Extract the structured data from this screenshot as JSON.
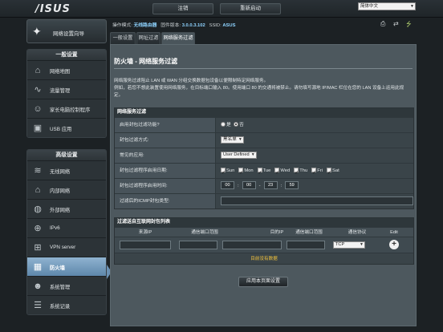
{
  "header": {
    "logo": "/ISUS",
    "logout_label": "注销",
    "reboot_label": "重新启动",
    "language": "简体中文"
  },
  "status": {
    "mode_label": "操作模式:",
    "mode_value": "无线路由器",
    "firmware_label": "固件版本:",
    "firmware_value": "3.0.0.3.102",
    "ssid_label": "SSID:",
    "ssid_value": "ASUS"
  },
  "sidebar": {
    "qis_label": "网络设置向导",
    "general_title": "一般设置",
    "general_items": [
      {
        "label": "网络地图",
        "icon": "network-map-icon"
      },
      {
        "label": "流量管理",
        "icon": "traffic-icon"
      },
      {
        "label": "家长电脑控制程序",
        "icon": "parental-control-icon"
      },
      {
        "label": "USB 应用",
        "icon": "usb-icon"
      }
    ],
    "advanced_title": "高级设置",
    "advanced_items": [
      {
        "label": "无线网络",
        "icon": "wireless-icon"
      },
      {
        "label": "内部网络",
        "icon": "lan-icon"
      },
      {
        "label": "外部网络",
        "icon": "wan-icon"
      },
      {
        "label": "IPv6",
        "icon": "ipv6-icon"
      },
      {
        "label": "VPN server",
        "icon": "vpn-icon"
      },
      {
        "label": "防火墙",
        "icon": "firewall-icon",
        "active": true
      },
      {
        "label": "系统管理",
        "icon": "admin-icon"
      },
      {
        "label": "系统记录",
        "icon": "syslog-icon"
      }
    ]
  },
  "tabs": [
    {
      "label": "一般设置"
    },
    {
      "label": "网址过滤"
    },
    {
      "label": "网络服务过滤",
      "active": true
    }
  ],
  "main": {
    "title": "防火墙 - 网络服务过滤",
    "desc1": "网络服务过滤阻止 LAN 或 WAN 分组交换数据包设备以便限制特定网络服务。",
    "desc2": "例如，若您不想此装置使用网络服务，在目标端口输入 80。使用端口 80 的交通将被禁止。请勿填写源地 IP/MAC 栏位在您的 LAN 设备上运用此规定。",
    "section_title": "网络服务过滤",
    "enable_label": "启用封包过滤功能?",
    "yes_label": "是",
    "no_label": "否",
    "filter_mode_label": "封包过滤方式:",
    "filter_mode_value": "黑名单",
    "well_known_label": "常见的应用:",
    "well_known_value": "User Defined",
    "days_label": "封包过滤程序启用日期:",
    "days": [
      "Sun",
      "Mon",
      "Tue",
      "Wed",
      "Thu",
      "Fri",
      "Sat"
    ],
    "time_label": "封包过滤程序启用时间:",
    "time_values": [
      "00",
      "00",
      "23",
      "59"
    ],
    "icmp_label": "过滤后的ICMP封包类型:",
    "list_title": "过滤送自互联网封包列表",
    "columns": [
      "来源IP",
      "通信端口范围",
      "目的IP",
      "通信端口范围",
      "通信协议",
      "Edit"
    ],
    "protocol_value": "TCP",
    "no_data": "目前没有数据",
    "apply_label": "应用本页面设置"
  }
}
